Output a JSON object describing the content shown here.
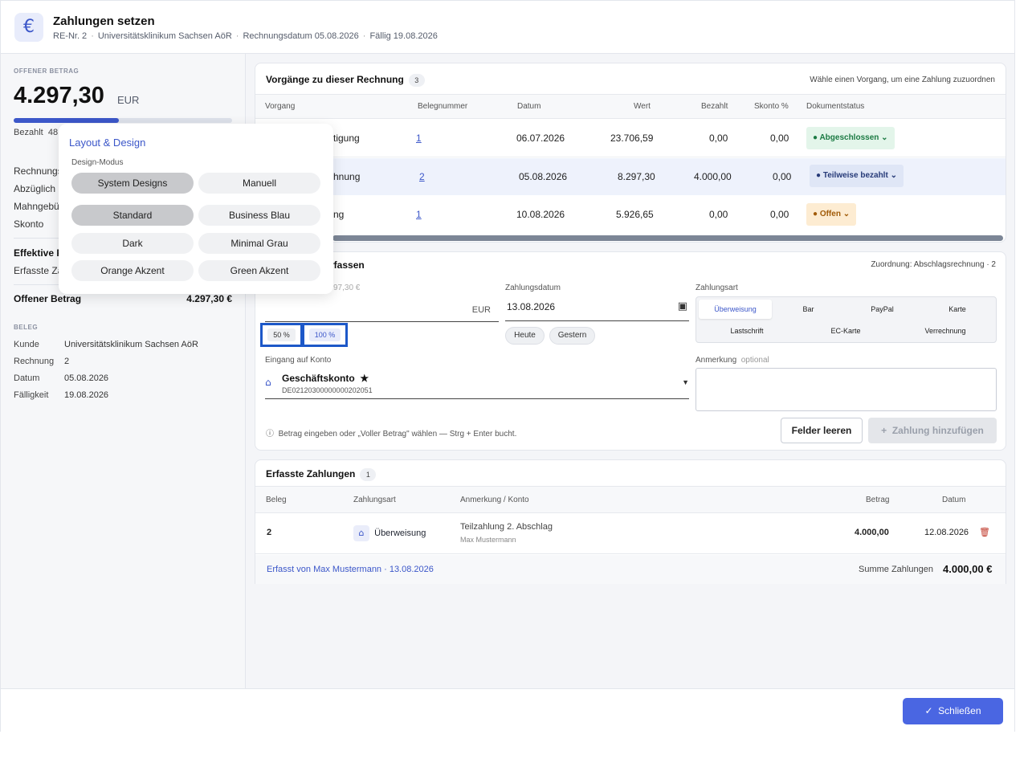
{
  "header": {
    "icon": "euro-icon",
    "title": "Zahlungen setzen",
    "re_nr": "RE-Nr. 2",
    "customer": "Universitätsklinikum Sachsen AöR",
    "invoice_date": "Rechnungsdatum 05.08.2026",
    "due": "Fällig 19.08.2026"
  },
  "left": {
    "open_caption": "OFFENER BETRAG",
    "open_amount": "4.297,30",
    "currency": "EUR",
    "progress_fraction": 0.48,
    "paid_label": "Bezahlt",
    "paid_value_partial": "48",
    "rows": [
      {
        "label": "Rechnungs"
      },
      {
        "label": "Abzüglich"
      },
      {
        "label": "Mahngebü"
      },
      {
        "label": "Skonto"
      }
    ],
    "effective_label": "Effektive F",
    "captured_label": "Erfasste Za",
    "open_total_label": "Offener Betrag",
    "open_total_value": "4.297,30 €",
    "beleg_caption": "BELEG",
    "beleg": [
      {
        "k": "Kunde",
        "v": "Universitätsklinikum Sachsen AöR"
      },
      {
        "k": "Rechnung",
        "v": "2"
      },
      {
        "k": "Datum",
        "v": "05.08.2026"
      },
      {
        "k": "Fälligkeit",
        "v": "19.08.2026"
      }
    ]
  },
  "popup": {
    "title": "Layout & Design",
    "mode_label": "Design-Modus",
    "modes": [
      "System Designs",
      "Manuell"
    ],
    "themes": [
      "Standard",
      "Business Blau",
      "Dark",
      "Minimal Grau",
      "Orange Akzent",
      "Green Akzent"
    ]
  },
  "vorgaenge": {
    "title": "Vorgänge zu dieser Rechnung",
    "count": "3",
    "hint": "Wähle einen Vorgang, um eine Zahlung zuzuordnen",
    "columns": [
      "Vorgang",
      "Belegnummer",
      "Datum",
      "Wert",
      "Bezahlt",
      "Skonto %",
      "Dokumentstatus"
    ],
    "rows": [
      {
        "vorgang": "tigung",
        "beleg": "1",
        "datum": "06.07.2026",
        "wert": "23.706,59",
        "bezahlt": "0,00",
        "skonto": "0,00",
        "status": "Abgeschlossen"
      },
      {
        "vorgang": "hnung",
        "beleg": "2",
        "datum": "05.08.2026",
        "wert": "8.297,30",
        "bezahlt": "4.000,00",
        "skonto": "0,00",
        "status": "Teilweise bezahlt"
      },
      {
        "vorgang": "ng",
        "beleg": "1",
        "datum": "10.08.2026",
        "wert": "5.926,65",
        "bezahlt": "0,00",
        "skonto": "0,00",
        "status": "Offen"
      }
    ]
  },
  "erfassen": {
    "title_partial": "rfassen",
    "assignment": "Zuordnung: Abschlagsrechnung · 2",
    "amount_hint_partial": "97,30 €",
    "currency": "EUR",
    "pct": [
      "50 %",
      "100 %"
    ],
    "date_label": "Zahlungsdatum",
    "date_value": "13.08.2026",
    "date_chips": [
      "Heute",
      "Gestern"
    ],
    "method_label": "Zahlungsart",
    "methods_row1": [
      "Überweisung",
      "Bar",
      "PayPal",
      "Karte"
    ],
    "methods_row2": [
      "Lastschrift",
      "EC-Karte",
      "Verrechnung"
    ],
    "account_label": "Eingang auf Konto",
    "account_name": "Geschäftskonto",
    "account_iban": "DE02120300000000202051",
    "note_label": "Anmerkung",
    "note_optional": "optional",
    "info": "Betrag eingeben oder „Voller Betrag\" wählen — Strg + Enter bucht.",
    "clear_btn": "Felder leeren",
    "add_btn": "Zahlung hinzufügen"
  },
  "erfasst": {
    "title": "Erfasste Zahlungen",
    "count": "1",
    "columns": [
      "Beleg",
      "Zahlungsart",
      "Anmerkung / Konto",
      "Betrag",
      "Datum"
    ],
    "row": {
      "beleg": "2",
      "art": "Überweisung",
      "note": "Teilzahlung 2. Abschlag",
      "user": "Max Mustermann",
      "betrag": "4.000,00",
      "datum": "12.08.2026"
    },
    "footer_left": "Erfasst von Max  Mustermann · 13.08.2026",
    "sum_label": "Summe Zahlungen",
    "sum_value": "4.000,00 €"
  },
  "footer": {
    "close": "Schließen"
  }
}
